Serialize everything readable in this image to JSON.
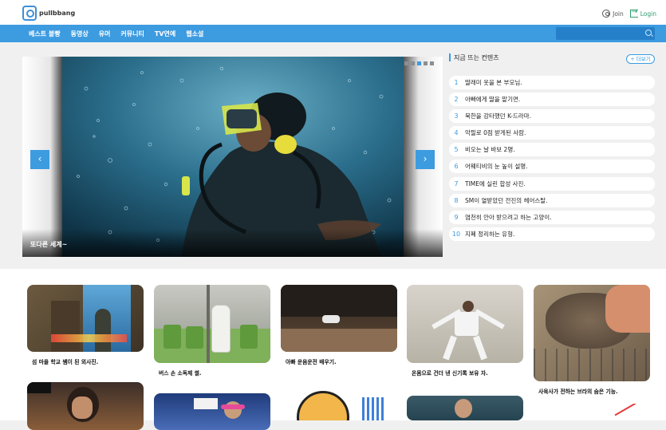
{
  "header": {
    "logo_text": "pullbbang",
    "join_label": "Join",
    "login_label": "Login"
  },
  "nav": {
    "items": [
      "베스트 볼빵",
      "동영상",
      "유머",
      "커뮤니티",
      "TV연예",
      "웹소설"
    ]
  },
  "hero": {
    "caption": "또다른 세계~",
    "prev_icon": "chevron-left-icon",
    "next_icon": "chevron-right-icon",
    "prev_glyph": "‹",
    "next_glyph": "›"
  },
  "trending": {
    "title": "지금 뜨는 컨텐츠",
    "more_label": "+ 더보기",
    "items": [
      {
        "num": "1",
        "text": "딸래미 옷을 본 부모님."
      },
      {
        "num": "2",
        "text": "아빠에게 딸을 맡기면."
      },
      {
        "num": "3",
        "text": "북한을 강타했던 K-드라마."
      },
      {
        "num": "4",
        "text": "악필로 0점 받게된 사람."
      },
      {
        "num": "5",
        "text": "비오는 날 바보 2명."
      },
      {
        "num": "6",
        "text": "어웨티비의 눈 높이 설명."
      },
      {
        "num": "7",
        "text": "TIME에 실린 합성 사진."
      },
      {
        "num": "8",
        "text": "SM이 열받았던 전진의 헤어스탈."
      },
      {
        "num": "9",
        "text": "염천히 안아 받으려고 하는 고양이."
      },
      {
        "num": "10",
        "text": "지폐 정리하는 유형."
      }
    ]
  },
  "cards": [
    {
      "title": "섬 마을 학교 쌤이 된 외사진."
    },
    {
      "title": "버스 손 소독제 썰."
    },
    {
      "title": "아빠 운음운전 배우기."
    },
    {
      "title": "온몸으로 건더 낸 신기록 보유 자."
    },
    {
      "title": "사육사가 전하는 브라의 숨은 기능."
    }
  ],
  "colors": {
    "accent": "#3d9be0",
    "search_bg": "#2580c9",
    "login_green": "#2a9d6a"
  }
}
